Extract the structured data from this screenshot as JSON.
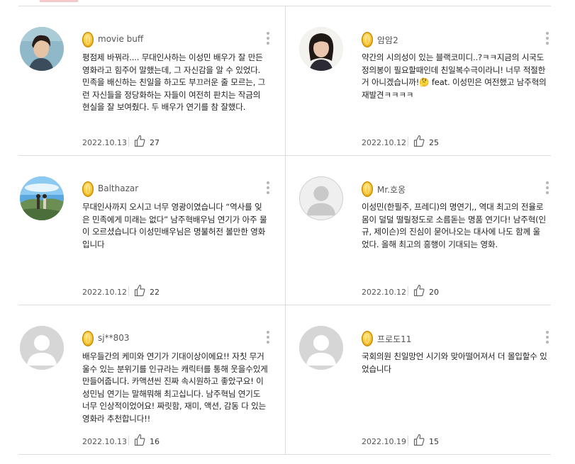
{
  "reviews": [
    {
      "nickname": "movie buff",
      "avatar": "vintage-portrait-photo",
      "text": "평점제 바꿔라.... 무대인사하는 이성민 배우가 잘 만든 영화라고 힘주어 말했는데, 그 자신감을 알 수 있었다. 민족을 배신하는 친일을 하고도 부끄러운 줄 모르는, 그런 자신들을 정당화하는 자들이 여전히 판치는 작금의 현실을 잘 보여줬다. 두 배우가 연기를 참 잘했다.",
      "date": "2022.10.13",
      "likes": "27"
    },
    {
      "nickname": "암암2",
      "avatar": "girl-portrait-photo",
      "text": "약간의 시의성이 있는 블랙코미디..?ㅋㅋ지금의 시국도 정의봉이 필요할때인데 친일복수극이라니! 너무 적절한거 아니겠습니까!🤔 feat. 이성민은 여전했고 남주혁의 재발견ㅋㅋㅋㅋ",
      "date": "2022.10.12",
      "likes": "25"
    },
    {
      "nickname": "Balthazar",
      "avatar": "couple-landscape-photo",
      "text": "무대인사까지 오시고 너무 영광이였습니다 “역사를 잊은 민족에게 미래는 없다” 남주혁배우님 연기가 아주 물이 오르셨습니다 이성민배우님은 명불허전 볼만한 영화입니다",
      "date": "2022.10.12",
      "likes": "22"
    },
    {
      "nickname": "Mr.호옹",
      "avatar": "default-profile",
      "text": "이성민(한필주, 프레디)의 명연기,, 역대 최고의 전율로 몸이 덜덜 떨릴정도로 소름돋는 명품 연기다! 남주혁(인규, 제이슨)의 진심이 묻어나오는 대사에 나도 함께 울었다. 올해 최고의 흥행이 기대되는 영화.",
      "date": "2022.10.12",
      "likes": "20"
    },
    {
      "nickname": "sj**803",
      "avatar": "default-profile",
      "text": "배우들간의 케미와 연기가 기대이상이에요!! 자칫 무거울수 있는 분위기를 인규라는 캐릭터를 통해 웃을수있게 만들어줍니다. 카액션씬 진짜 속시원하고 좋았구요! 이성민님 연기는 말해뭐해 최고십니다. 남주혁님 연기도 너무 인상적이었어요! 짜릿함, 재미, 액션, 감동 다 있는 영화라 추천합니다!!",
      "date": "2022.10.13",
      "likes": "16"
    },
    {
      "nickname": "프로도11",
      "avatar": "default-profile",
      "text": "국회의원 친일망언 시기와 맞아떨어져서 더 몰입할수 있었습니다",
      "date": "2022.10.19",
      "likes": "15"
    }
  ],
  "icons": {
    "badge": "gold-coin-icon",
    "more": "more-vertical-icon",
    "like": "thumbs-up-icon"
  },
  "colors": {
    "coin": "#f6c22a",
    "divider": "#dcdcdc",
    "text": "#1e1e1e"
  }
}
